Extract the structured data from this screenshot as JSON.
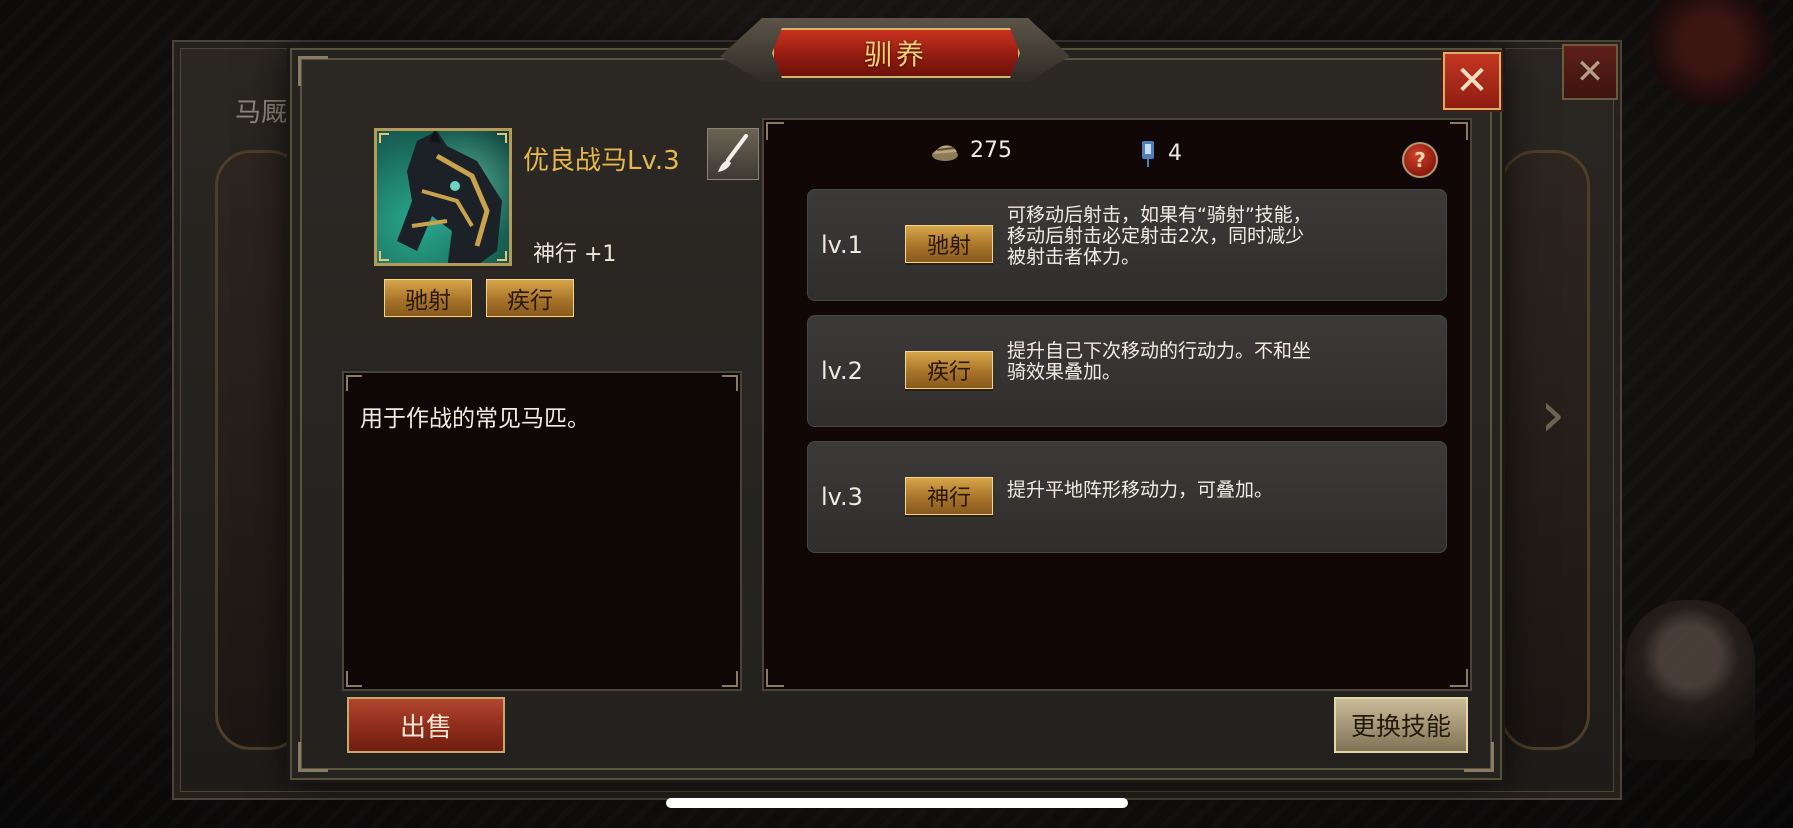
{
  "background": {
    "window_title": "马厩"
  },
  "dialog": {
    "title": "驯养",
    "close_label": "✕"
  },
  "horse": {
    "name": "优良战马Lv.3",
    "attribute": "神行 +1",
    "skills": [
      "驰射",
      "疾行"
    ],
    "description": "用于作战的常见马匹。"
  },
  "resources": {
    "fodder": "275",
    "token": "4",
    "help_label": "?"
  },
  "skill_levels": [
    {
      "level": "lv.1",
      "skill": "驰射",
      "desc_lines": [
        "可移动后射击，如果有“骑射”技能，",
        "移动后射击必定射击2次，同时减少",
        "被射击者体力。"
      ]
    },
    {
      "level": "lv.2",
      "skill": "疾行",
      "desc_lines": [
        "提升自己下次移动的行动力。不和坐",
        "骑效果叠加。"
      ]
    },
    {
      "level": "lv.3",
      "skill": "神行",
      "desc_lines": [
        "提升平地阵形移动力，可叠加。"
      ]
    }
  ],
  "buttons": {
    "sell": "出售",
    "change_skill": "更换技能"
  },
  "colors": {
    "title_red": "#8e1b10",
    "gold_text": "#e8b64a",
    "chip_gold": "#d7a64a"
  }
}
